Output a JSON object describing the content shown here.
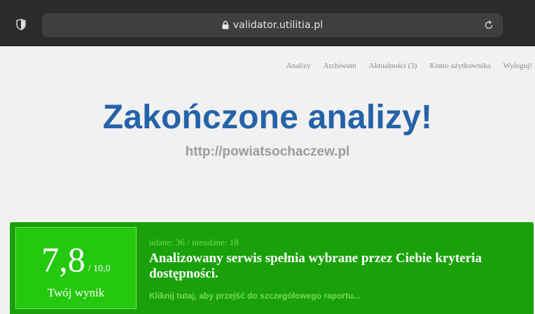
{
  "browser": {
    "url": "validator.utilitia.pl",
    "icons": [
      "shield-icon",
      "lock-icon",
      "reload-icon"
    ]
  },
  "nav": {
    "items": [
      "Analizy",
      "Archiwum",
      "Aktualności (3)",
      "Konto użytkownika",
      "Wyloguj!"
    ]
  },
  "header": {
    "title": "Zakończone analizy!",
    "site_url": "http://powiatsochaczew.pl"
  },
  "result": {
    "score": "7,8",
    "score_max": "/ 10,0",
    "score_label": "Twój wynik",
    "counts": "udane: 36 / nieudane: 18",
    "message": "Analizowany serwis spełnia wybrane przez Ciebie kryteria dostępności.",
    "report_link": "Kliknij tutaj, aby przejść do szczegółowego raportu..."
  },
  "colors": {
    "title_blue": "#2563a8",
    "result_green": "#1aa10a",
    "score_green": "#24c80f"
  }
}
